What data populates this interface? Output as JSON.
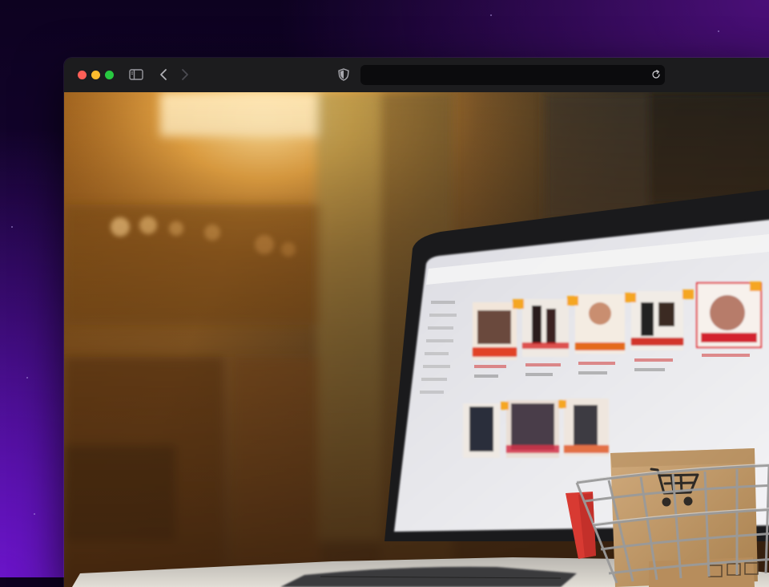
{
  "browser": {
    "traffic_lights": {
      "close": "#ff5f57",
      "minimize": "#febc2e",
      "zoom": "#28c840"
    },
    "icons": {
      "sidebar": "sidebar-icon",
      "back": "chevron-left-icon",
      "forward": "chevron-right-icon",
      "privacy": "shield-icon",
      "reload": "reload-icon"
    },
    "address": {
      "value": "",
      "placeholder": ""
    }
  },
  "content": {
    "image": "photo-laptop-online-shopping-with-cart",
    "colors": {
      "bokeh": "#f0a53c",
      "screen": "#ececee",
      "box": "#c29a6b",
      "cart_tag": "#d93a34"
    }
  }
}
